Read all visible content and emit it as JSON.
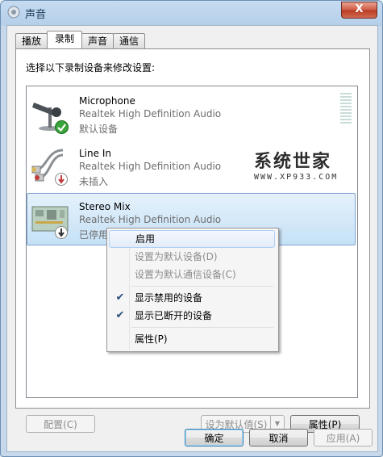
{
  "window": {
    "title": "声音",
    "close_label": "X"
  },
  "tabs": [
    {
      "label": "播放"
    },
    {
      "label": "录制"
    },
    {
      "label": "声音"
    },
    {
      "label": "通信"
    }
  ],
  "instruction": "选择以下录制设备来修改设置:",
  "devices": [
    {
      "name": "Microphone",
      "driver": "Realtek High Definition Audio",
      "status": "默认设备"
    },
    {
      "name": "Line In",
      "driver": "Realtek High Definition Audio",
      "status": "未插入"
    },
    {
      "name": "Stereo Mix",
      "driver": "Realtek High Definition Audio",
      "status": "已停用"
    }
  ],
  "watermark": {
    "main": "系统世家",
    "sub": "WWW.XP933.COM"
  },
  "context_menu": {
    "items": [
      {
        "label": "启用"
      },
      {
        "label": "设置为默认设备(D)"
      },
      {
        "label": "设置为默认通信设备(C)"
      },
      {
        "label": "显示禁用的设备"
      },
      {
        "label": "显示已断开的设备"
      },
      {
        "label": "属性(P)"
      }
    ]
  },
  "panel_buttons": {
    "configure": "配置(C)",
    "set_default": "设为默认值(S)",
    "properties": "属性(P)"
  },
  "dialog_buttons": {
    "ok": "确定",
    "cancel": "取消",
    "apply": "应用(A)"
  }
}
